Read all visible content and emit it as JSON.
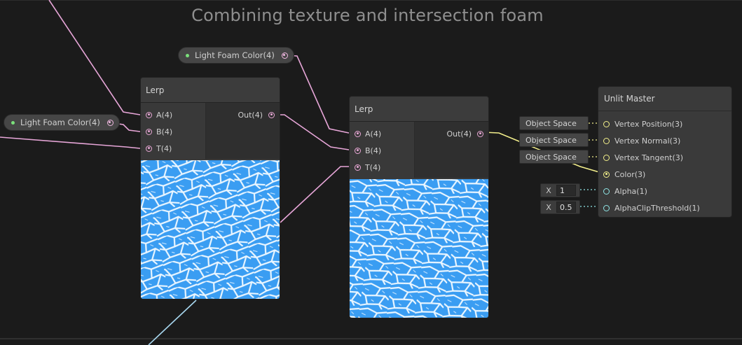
{
  "group_title": "Combining texture and intersection foam",
  "properties": [
    {
      "label": "Light Foam Color(4)"
    },
    {
      "label": "Light Foam Color(4)"
    }
  ],
  "lerp_nodes": [
    {
      "title": "Lerp",
      "inputs": [
        "A(4)",
        "B(4)",
        "T(4)"
      ],
      "output": "Out(4)"
    },
    {
      "title": "Lerp",
      "inputs": [
        "A(4)",
        "B(4)",
        "T(4)"
      ],
      "output": "Out(4)"
    }
  ],
  "master": {
    "title": "Unlit Master",
    "slots": [
      "Vertex Position(3)",
      "Vertex Normal(3)",
      "Vertex Tangent(3)",
      "Color(3)",
      "Alpha(1)",
      "AlphaClipThreshold(1)"
    ],
    "space_chips": [
      "Object Space",
      "Object Space",
      "Object Space"
    ],
    "alpha": {
      "axis": "X",
      "value": "1"
    },
    "alpha_clip": {
      "axis": "X",
      "value": "0.5"
    }
  },
  "colors": {
    "vector4_wire": "#e7a6d8",
    "vector3_wire": "#f3ef8c",
    "vector1_wire": "#8fe6e6",
    "texture_blue": "#3a9df2",
    "foam_white": "#eaf6ff"
  }
}
